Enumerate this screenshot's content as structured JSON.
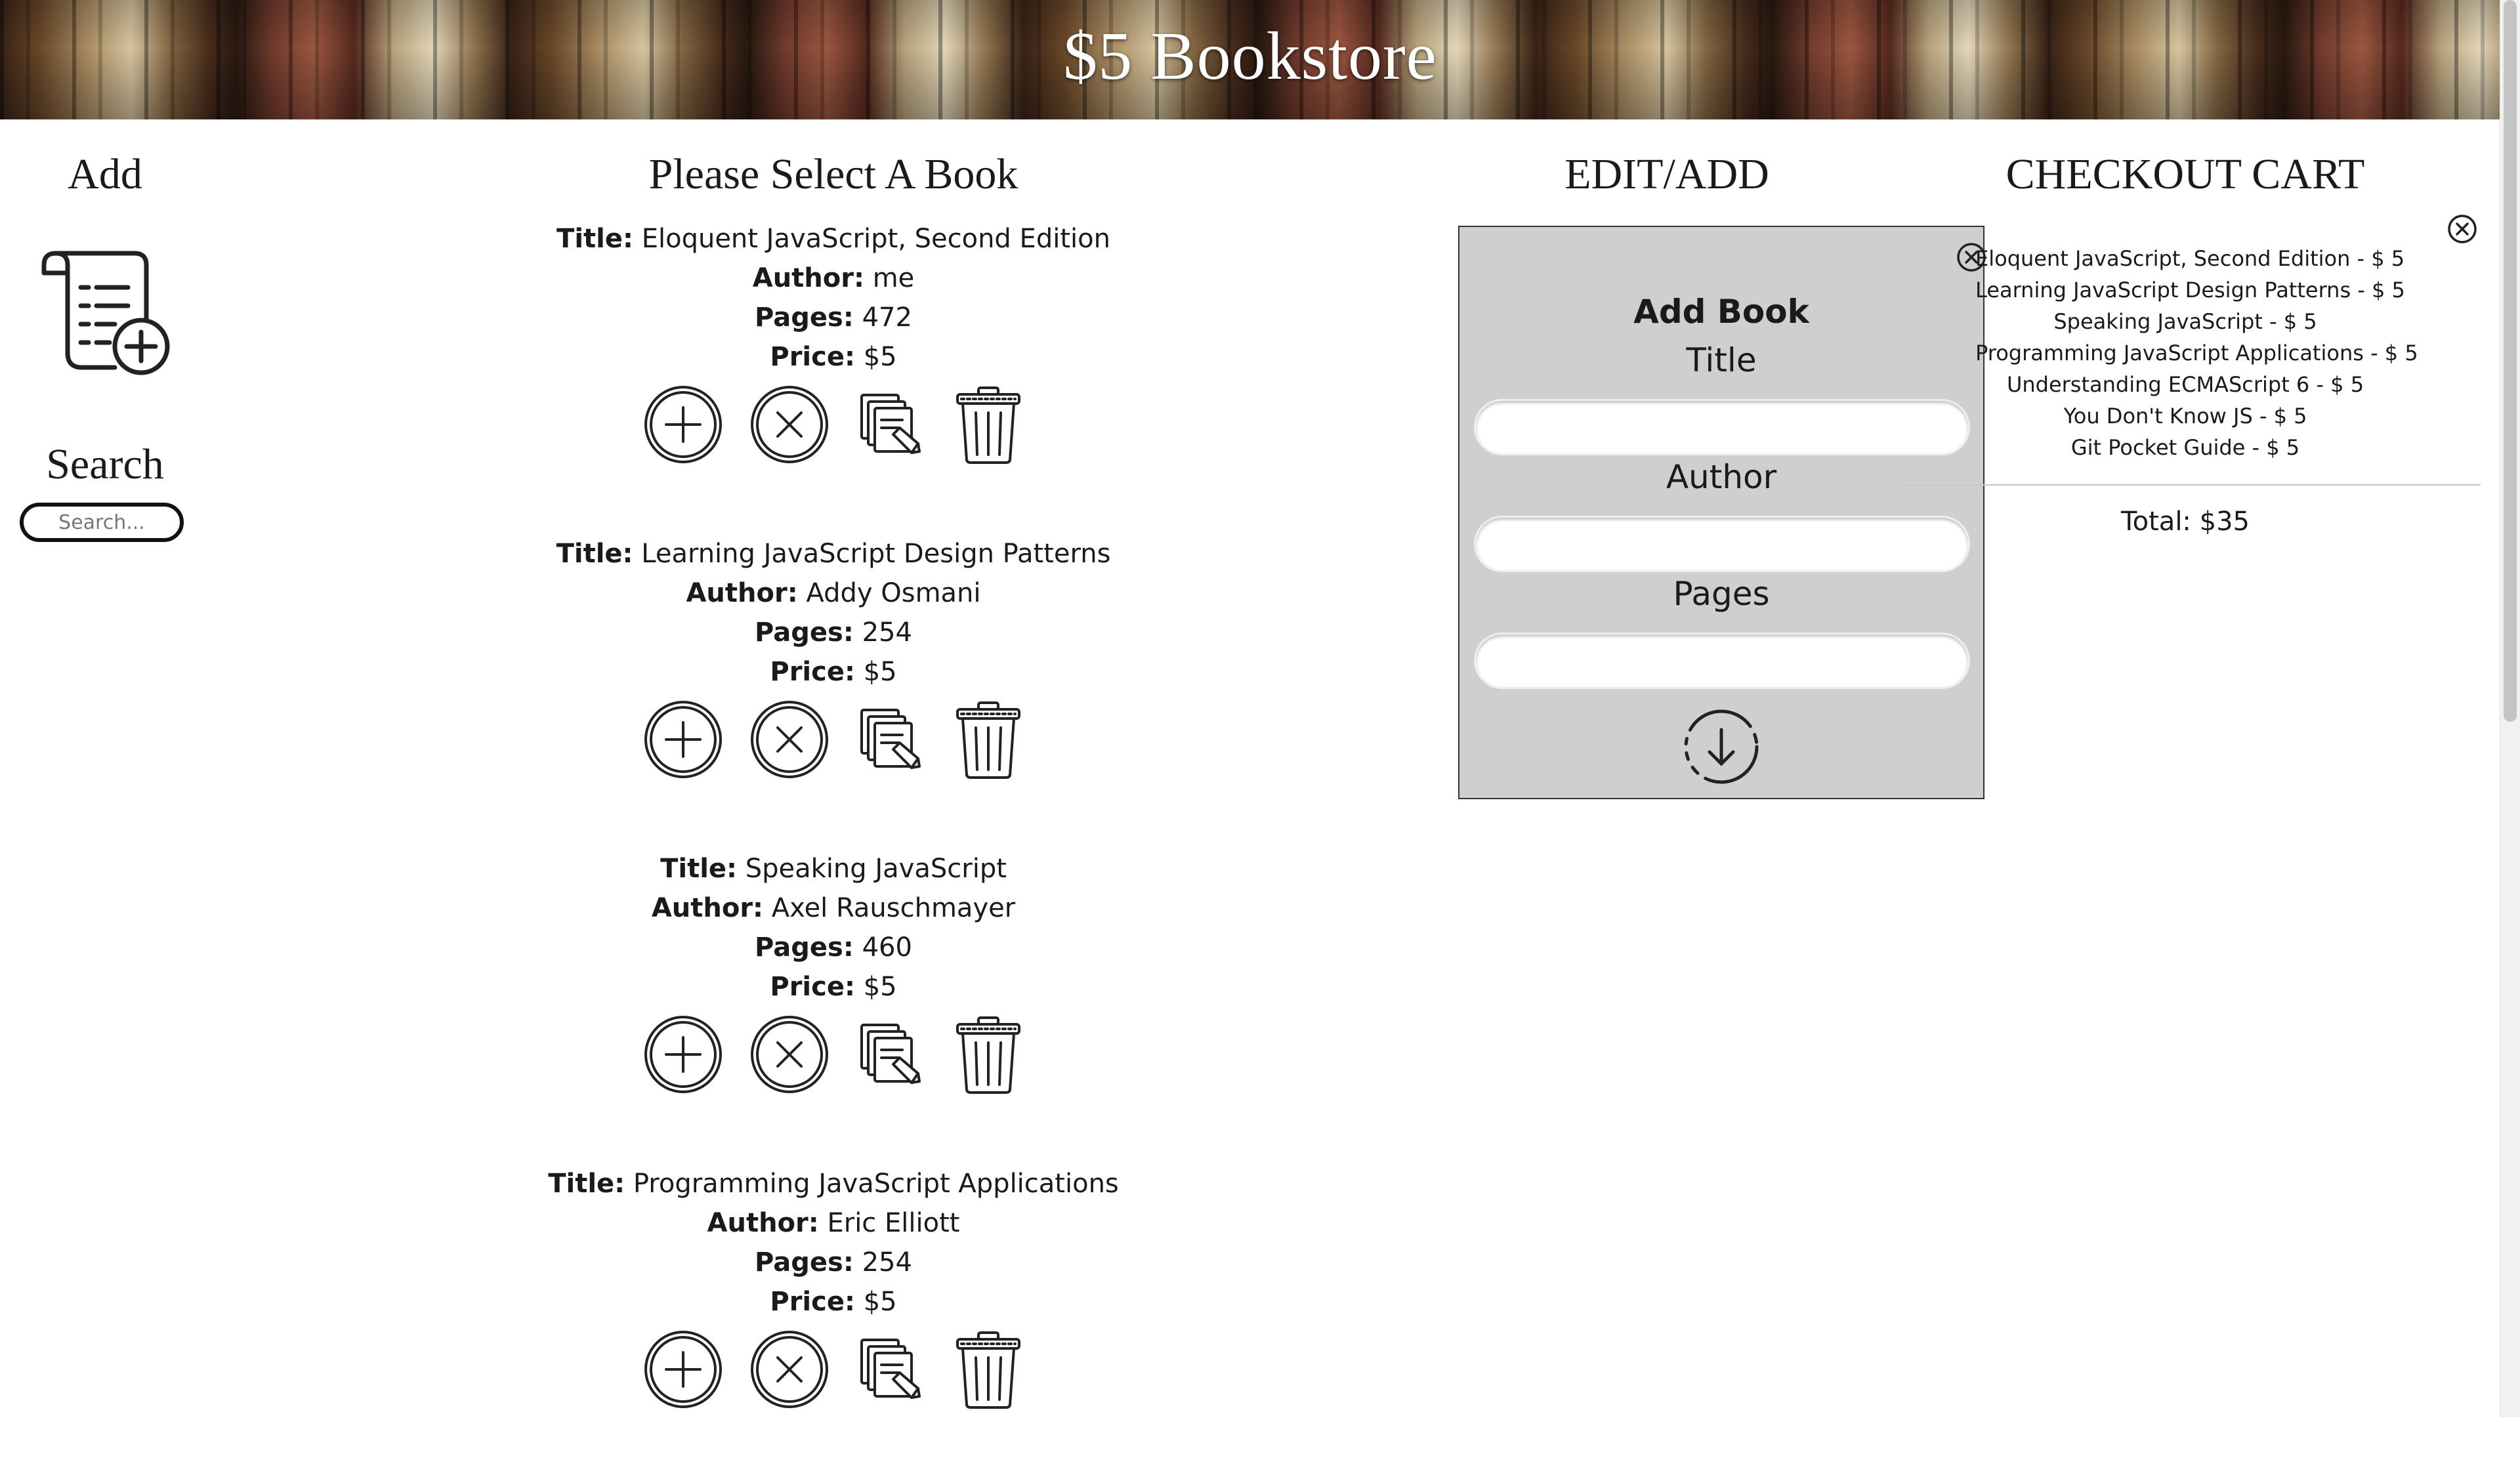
{
  "header": {
    "title": "$5 Bookstore"
  },
  "left": {
    "add_heading": "Add",
    "search_heading": "Search",
    "search_placeholder": "Search..."
  },
  "books_section": {
    "heading": "Please Select A Book",
    "field_labels": {
      "title": "Title:",
      "author": "Author:",
      "pages": "Pages:",
      "price": "Price:"
    },
    "books": [
      {
        "title": "Eloquent JavaScript, Second Edition",
        "author": "me",
        "pages": "472",
        "price": "$5"
      },
      {
        "title": "Learning JavaScript Design Patterns",
        "author": "Addy Osmani",
        "pages": "254",
        "price": "$5"
      },
      {
        "title": "Speaking JavaScript",
        "author": "Axel Rauschmayer",
        "pages": "460",
        "price": "$5"
      },
      {
        "title": "Programming JavaScript Applications",
        "author": "Eric Elliott",
        "pages": "254",
        "price": "$5"
      }
    ],
    "action_icons": [
      "add-to-cart-icon",
      "remove-from-cart-icon",
      "edit-icon",
      "trash-icon"
    ]
  },
  "edit_add": {
    "heading": "EDIT/ADD",
    "panel_title": "Add Book",
    "title_label": "Title",
    "author_label": "Author",
    "pages_label": "Pages",
    "title_value": "",
    "author_value": "",
    "pages_value": ""
  },
  "cart": {
    "heading": "CHECKOUT CART",
    "items": [
      "Eloquent JavaScript, Second Edition - $ 5",
      "Learning JavaScript Design Patterns - $ 5",
      "Speaking JavaScript - $ 5",
      "Programming JavaScript Applications - $ 5",
      "Understanding ECMAScript 6 - $ 5",
      "You Don't Know JS - $ 5",
      "Git Pocket Guide - $ 5"
    ],
    "total": "Total: $35"
  },
  "colors": {
    "header_text": "#ffffff",
    "panel_bg": "#cfcfcf",
    "icon_stroke": "#222222"
  }
}
